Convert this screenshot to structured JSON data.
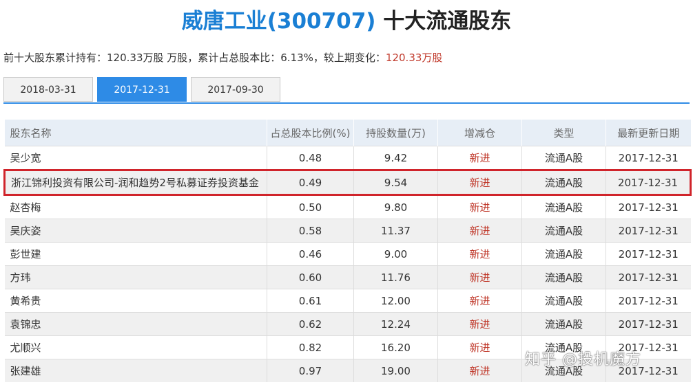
{
  "title": {
    "company": "威唐工业(300707)",
    "suffix": " 十大流通股东"
  },
  "summary": {
    "prefix": "前十大股东累计持有：120.33万股 万股，累计占总股本比：6.13%，较上期变化：",
    "change": "120.33万股"
  },
  "tabs": [
    {
      "label": "2018-03-31",
      "active": false
    },
    {
      "label": "2017-12-31",
      "active": true
    },
    {
      "label": "2017-09-30",
      "active": false
    }
  ],
  "table": {
    "headers": [
      "股东名称",
      "占总股本比例(%)",
      "持股数量(万)",
      "增减仓",
      "类型",
      "最新更新日期"
    ],
    "rows": [
      {
        "name": "吴少宽",
        "ratio": "0.48",
        "shares": "9.42",
        "change": "新进",
        "type": "流通A股",
        "date": "2017-12-31"
      },
      {
        "name": "浙江锦利投资有限公司-润和趋势2号私募证券投资基金",
        "ratio": "0.49",
        "shares": "9.54",
        "change": "新进",
        "type": "流通A股",
        "date": "2017-12-31"
      },
      {
        "name": "赵杏梅",
        "ratio": "0.50",
        "shares": "9.80",
        "change": "新进",
        "type": "流通A股",
        "date": "2017-12-31"
      },
      {
        "name": "吴庆姿",
        "ratio": "0.58",
        "shares": "11.37",
        "change": "新进",
        "type": "流通A股",
        "date": "2017-12-31"
      },
      {
        "name": "彭世建",
        "ratio": "0.46",
        "shares": "9.00",
        "change": "新进",
        "type": "流通A股",
        "date": "2017-12-31"
      },
      {
        "name": "方玮",
        "ratio": "0.60",
        "shares": "11.76",
        "change": "新进",
        "type": "流通A股",
        "date": "2017-12-31"
      },
      {
        "name": "黄希贵",
        "ratio": "0.61",
        "shares": "12.00",
        "change": "新进",
        "type": "流通A股",
        "date": "2017-12-31"
      },
      {
        "name": "袁锦忠",
        "ratio": "0.62",
        "shares": "12.24",
        "change": "新进",
        "type": "流通A股",
        "date": "2017-12-31"
      },
      {
        "name": "尤顺兴",
        "ratio": "0.82",
        "shares": "16.20",
        "change": "新进",
        "type": "流通A股",
        "date": "2017-12-31"
      },
      {
        "name": "张建雄",
        "ratio": "0.97",
        "shares": "19.00",
        "change": "新进",
        "type": "流通A股",
        "date": "2017-12-31"
      }
    ]
  },
  "watermark": "知乎 @投机魔方",
  "colors": {
    "accent": "#2e8be6",
    "title_blue": "#1a7fd4",
    "highlight_red": "#d0242b",
    "change_red": "#c0392b"
  }
}
